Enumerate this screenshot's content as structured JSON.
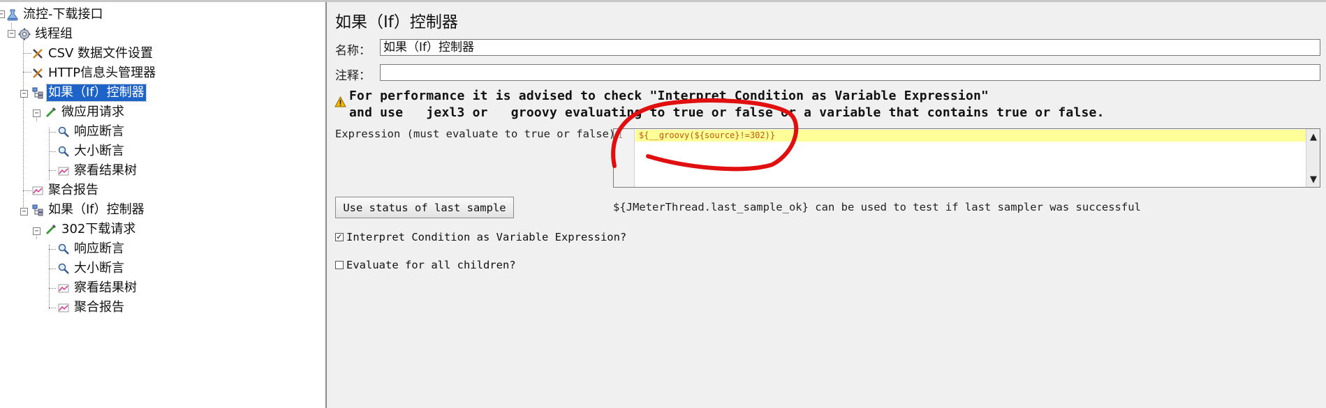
{
  "tree": {
    "items": [
      {
        "label": "流控-下载接口",
        "icon": "test-plan-icon"
      },
      {
        "label": "线程组",
        "icon": "gear-icon"
      },
      {
        "label": "CSV 数据文件设置",
        "icon": "wrench-icon"
      },
      {
        "label": "HTTP信息头管理器",
        "icon": "wrench-icon"
      },
      {
        "label": "如果（If）控制器",
        "icon": "if-controller-icon",
        "selected": true
      },
      {
        "label": "微应用请求",
        "icon": "pipette-icon"
      },
      {
        "label": "响应断言",
        "icon": "magnifier-icon"
      },
      {
        "label": "大小断言",
        "icon": "magnifier-icon"
      },
      {
        "label": "察看结果树",
        "icon": "graph-icon"
      },
      {
        "label": "聚合报告",
        "icon": "graph-icon"
      },
      {
        "label": "如果（If）控制器",
        "icon": "if-controller-icon"
      },
      {
        "label": "302下载请求",
        "icon": "pipette-icon"
      },
      {
        "label": "响应断言",
        "icon": "magnifier-icon"
      },
      {
        "label": "大小断言",
        "icon": "magnifier-icon"
      },
      {
        "label": "察看结果树",
        "icon": "graph-icon"
      },
      {
        "label": "聚合报告",
        "icon": "graph-icon"
      }
    ]
  },
  "panel": {
    "title": "如果（If）控制器",
    "name_label": "名称：",
    "name_value": "如果（If）控制器",
    "comment_label": "注释：",
    "comment_value": "",
    "warning_line1": "For performance it is advised to check \"Interpret Condition as Variable Expression\"",
    "warning_line2": "and use   jexl3 or   groovy evaluating to true or false or a variable that contains true or false.",
    "expression_label": "Expression (must evaluate to true or false)",
    "editor": {
      "line_number": "1",
      "code": "${__groovy(${source}!=302)}"
    },
    "last_sample_button": "Use status of last sample",
    "hint": "${JMeterThread.last_sample_ok} can be used to test if last sampler was successful",
    "interpret_checkbox": {
      "label": "Interpret Condition as Variable Expression?",
      "checked": true,
      "mark": "✓"
    },
    "evaluate_checkbox": {
      "label": "Evaluate for all children?",
      "checked": false,
      "mark": ""
    }
  },
  "colors": {
    "selection": "#1e64c8",
    "annotation": "#e01010",
    "editor_line_highlight": "#ffff99",
    "code_text": "#c05800",
    "panel_background": "#f0f0f0"
  }
}
